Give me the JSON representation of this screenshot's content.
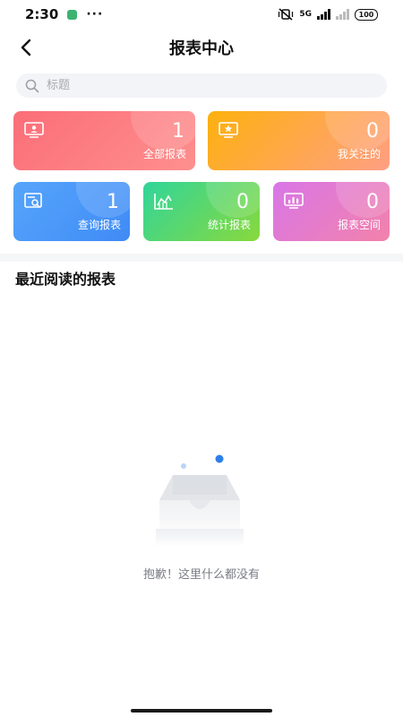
{
  "status_bar": {
    "time": "2:30",
    "dots": "···",
    "network": "5G",
    "battery": "100"
  },
  "nav": {
    "title": "报表中心",
    "back_icon": "chevron-left-icon"
  },
  "search": {
    "placeholder": "标题",
    "value": ""
  },
  "cards": [
    {
      "key": "all",
      "label": "全部报表",
      "count": "1",
      "icon": "monitor-user-icon",
      "colors": [
        "#fb6e78",
        "#fe8f8e"
      ]
    },
    {
      "key": "followed",
      "label": "我关注的",
      "count": "0",
      "icon": "monitor-star-icon",
      "colors": [
        "#fdb10e",
        "#fe9f84"
      ]
    },
    {
      "key": "query",
      "label": "查询报表",
      "count": "1",
      "icon": "search-document-icon",
      "colors": [
        "#56a5fb",
        "#3f8bf6"
      ]
    },
    {
      "key": "stats",
      "label": "统计报表",
      "count": "0",
      "icon": "chart-line-icon",
      "colors": [
        "#31d59a",
        "#88d93c"
      ]
    },
    {
      "key": "space",
      "label": "报表空间",
      "count": "0",
      "icon": "bar-chart-icon",
      "colors": [
        "#d976e8",
        "#f282aa"
      ]
    }
  ],
  "recent": {
    "title": "最近阅读的报表",
    "empty_text": "抱歉！这里什么都没有"
  }
}
